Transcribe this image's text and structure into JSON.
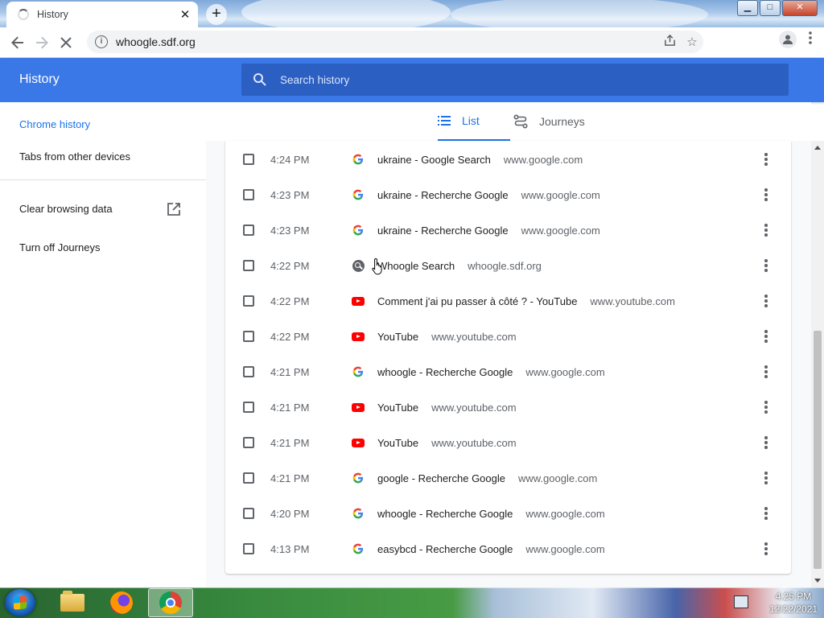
{
  "browser": {
    "tab_title": "History",
    "tab_close": "✕",
    "new_tab": "+",
    "url": "whoogle.sdf.org",
    "window_buttons": {
      "minimize": "▁",
      "maximize": "□",
      "close": "✕"
    }
  },
  "toolbar": {
    "back_icon": "arrow-left-icon",
    "forward_icon": "arrow-right-icon",
    "reload_icon": "stop-icon",
    "share_icon": "share-icon",
    "bookmark_icon": "star-icon",
    "profile_icon": "person-icon",
    "menu_icon": "kebab-icon"
  },
  "header": {
    "title": "History",
    "search_placeholder": "Search history",
    "color": "#3b78e7"
  },
  "sidebar": {
    "items": [
      {
        "label": "Chrome history",
        "active": true
      },
      {
        "label": "Tabs from other devices",
        "active": false
      },
      {
        "label": "Clear browsing data",
        "active": false,
        "icon": "open-in-new-icon"
      },
      {
        "label": "Turn off Journeys",
        "active": false
      }
    ]
  },
  "view_tabs": {
    "list": "List",
    "journeys": "Journeys"
  },
  "history": [
    {
      "time": "4:24 PM",
      "title": "ukraine - Google Search",
      "domain": "www.google.com",
      "favicon": "google"
    },
    {
      "time": "4:23 PM",
      "title": "ukraine - Recherche Google",
      "domain": "www.google.com",
      "favicon": "google"
    },
    {
      "time": "4:23 PM",
      "title": "ukraine - Recherche Google",
      "domain": "www.google.com",
      "favicon": "google"
    },
    {
      "time": "4:22 PM",
      "title": "Whoogle Search",
      "domain": "whoogle.sdf.org",
      "favicon": "whoogle"
    },
    {
      "time": "4:22 PM",
      "title": "Comment j'ai pu passer à côté ? - YouTube",
      "domain": "www.youtube.com",
      "favicon": "youtube"
    },
    {
      "time": "4:22 PM",
      "title": "YouTube",
      "domain": "www.youtube.com",
      "favicon": "youtube"
    },
    {
      "time": "4:21 PM",
      "title": "whoogle - Recherche Google",
      "domain": "www.google.com",
      "favicon": "google"
    },
    {
      "time": "4:21 PM",
      "title": "YouTube",
      "domain": "www.youtube.com",
      "favicon": "youtube"
    },
    {
      "time": "4:21 PM",
      "title": "YouTube",
      "domain": "www.youtube.com",
      "favicon": "youtube"
    },
    {
      "time": "4:21 PM",
      "title": "google - Recherche Google",
      "domain": "www.google.com",
      "favicon": "google"
    },
    {
      "time": "4:20 PM",
      "title": "whoogle - Recherche Google",
      "domain": "www.google.com",
      "favicon": "google"
    },
    {
      "time": "4:13 PM",
      "title": "easybcd - Recherche Google",
      "domain": "www.google.com",
      "favicon": "google"
    }
  ],
  "taskbar": {
    "apps": [
      "windows-explorer",
      "firefox",
      "chrome"
    ],
    "time": "4:25 PM",
    "date": "12/22/2021"
  }
}
